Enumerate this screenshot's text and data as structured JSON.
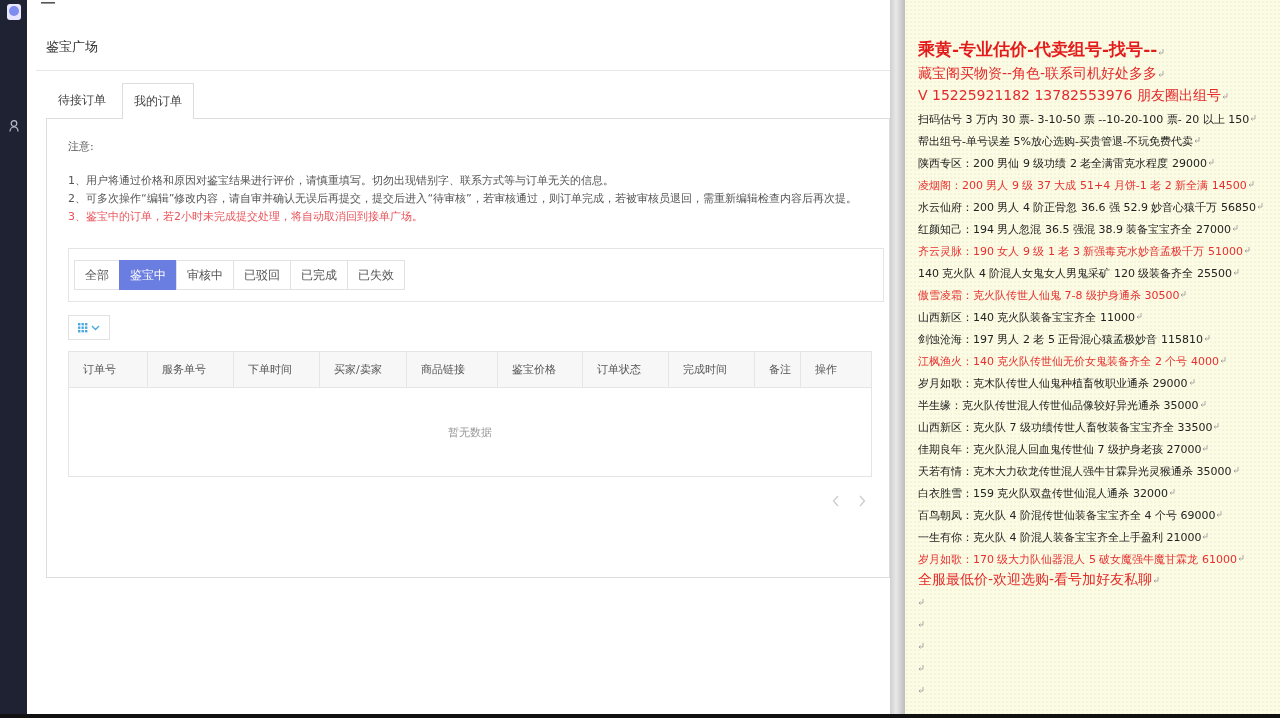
{
  "page": {
    "title": "鉴宝广场"
  },
  "tabs": [
    {
      "label": "待接订单",
      "selected": false
    },
    {
      "label": "我的订单",
      "selected": true
    }
  ],
  "notice": {
    "heading": "注意:",
    "items": [
      {
        "text": "1、用户将通过价格和原因对鉴宝结果进行评价，请慎重填写。切勿出现错别字、联系方式等与订单无关的信息。",
        "warning": false
      },
      {
        "text": "2、可多次操作“编辑”修改内容，请自审并确认无误后再提交，提交后进入“待审核”，若审核通过，则订单完成，若被审核员退回，需重新编辑检查内容后再次提。",
        "warning": false
      },
      {
        "text": "3、鉴宝中的订单，若2小时未完成提交处理，将自动取消回到接单广场。",
        "warning": true
      }
    ]
  },
  "filters": [
    {
      "label": "全部",
      "selected": false
    },
    {
      "label": "鉴宝中",
      "selected": true
    },
    {
      "label": "审核中",
      "selected": false
    },
    {
      "label": "已驳回",
      "selected": false
    },
    {
      "label": "已完成",
      "selected": false
    },
    {
      "label": "已失效",
      "selected": false
    }
  ],
  "table": {
    "columns": [
      "订单号",
      "服务单号",
      "下单时间",
      "买家/卖家",
      "商品链接",
      "鉴宝价格",
      "订单状态",
      "完成时间",
      "备注",
      "操作"
    ],
    "empty_text": "暂无数据"
  },
  "document": {
    "lines": [
      {
        "kind": "heading",
        "text": "乘黄-专业估价-代卖组号-找号--"
      },
      {
        "kind": "highlight",
        "text": "藏宝阁买物资--角色-联系司机好处多多"
      },
      {
        "kind": "highlight",
        "text": "V 15225921182    13782553976 朋友圈出组号"
      },
      {
        "kind": "plain",
        "text": "扫码估号 3 万内 30 票- 3-10-50 票  --10-20-100 票- 20 以上 150"
      },
      {
        "kind": "plain",
        "text": "帮出组号-单号误差 5%放心选购-买贵管退-不玩免费代卖"
      },
      {
        "kind": "plain",
        "text": "陕西专区：200 男仙 9 级功绩 2 老全满雷克水程度 29000"
      },
      {
        "kind": "red",
        "text": "凌烟阁：200 男人 9 级 37 大成 51+4 月饼-1 老 2 新全满 14500"
      },
      {
        "kind": "plain",
        "text": "水云仙府：200 男人 4 阶正骨忽 36.6 强 52.9 妙音心猿千万 56850"
      },
      {
        "kind": "plain",
        "text": "红颜知己：194 男人忽混 36.5 强混 38.9 装备宝宝齐全 27000"
      },
      {
        "kind": "red",
        "text": "齐云灵脉：190 女人 9 级 1 老 3 新强毒克水妙音孟极千万 51000"
      },
      {
        "kind": "plain",
        "text": "140 克火队 4 阶混人女鬼女人男鬼采矿 120 级装备齐全 25500"
      },
      {
        "kind": "red",
        "text": "傲雪凌霜：克火队传世人仙鬼 7-8 级护身通杀 30500"
      },
      {
        "kind": "plain",
        "text": "山西新区：140 克火队装备宝宝齐全 11000"
      },
      {
        "kind": "plain",
        "text": "剑蚀沧海：197 男人 2 老 5 正骨混心猿孟极妙音 115810"
      },
      {
        "kind": "red",
        "text": "江枫渔火：140 克火队传世仙无价女鬼装备齐全 2 个号 4000"
      },
      {
        "kind": "plain",
        "text": "岁月如歌：克木队传世人仙鬼种植畜牧职业通杀 29000"
      },
      {
        "kind": "plain",
        "text": "半生缘：克火队传世混人传世仙品像较好异光通杀 35000"
      },
      {
        "kind": "plain",
        "text": "山西新区：克火队 7 级功绩传世人畜牧装备宝宝齐全 33500"
      },
      {
        "kind": "plain",
        "text": "佳期良年：克火队混人回血鬼传世仙 7 级护身老孩 27000"
      },
      {
        "kind": "plain",
        "text": "天若有情：克木大力砍龙传世混人强牛甘霖异光灵猴通杀 35000"
      },
      {
        "kind": "plain",
        "text": "白衣胜雪：159 克火队双盘传世仙混人通杀 32000"
      },
      {
        "kind": "plain",
        "text": "百鸟朝凤：克火队 4 阶混传世仙装备宝宝齐全 4 个号 69000"
      },
      {
        "kind": "plain",
        "text": "一生有你：克火队 4 阶混人装备宝宝齐全上手盈利 21000"
      },
      {
        "kind": "red",
        "text": "岁月如歌：170 级大力队仙器混人 5 破女魔强牛魔甘霖龙 61000"
      },
      {
        "kind": "highlight",
        "text": "全服最低价-欢迎选购-看号加好友私聊"
      },
      {
        "kind": "empty"
      },
      {
        "kind": "empty"
      },
      {
        "kind": "empty"
      },
      {
        "kind": "empty"
      },
      {
        "kind": "empty"
      }
    ]
  }
}
